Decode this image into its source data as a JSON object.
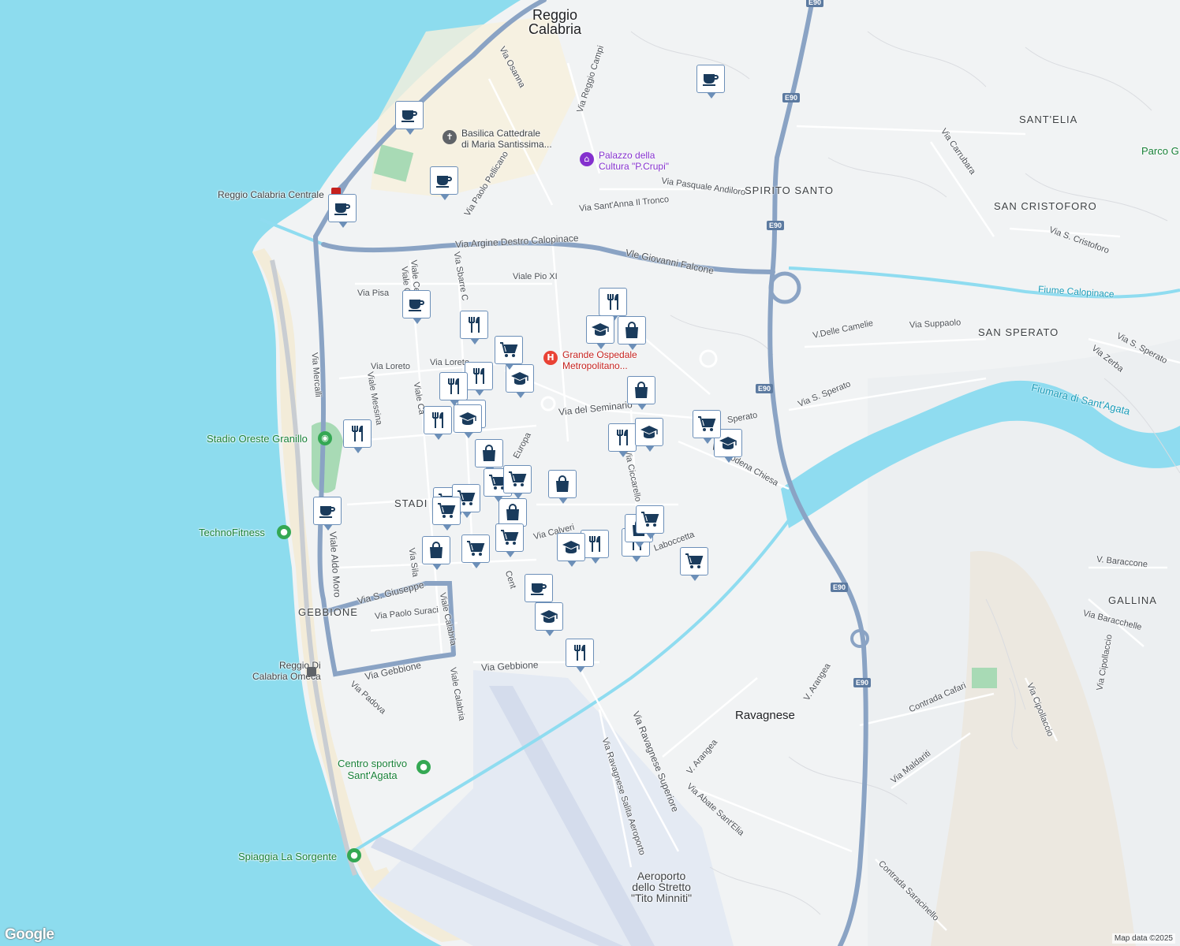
{
  "map": {
    "labels": {
      "city": "Reggio\nCalabria",
      "ravagnese": "Ravagnese",
      "aeroporto": "Aeroporto\ndello Stretto\n\"Tito Minniti\"",
      "basilica": "Basilica Cattedrale\ndi Maria Santissima...",
      "palazzo": "Palazzo della\nCultura \"P.Crupi\"",
      "ospedale": "Grande Ospedale\nMetropolitano...",
      "stazione": "Reggio Calabria Centrale",
      "omeca": "Reggio Di\nCalabria Omeca",
      "stadio": "Stadio Oreste Granillo",
      "technofitness": "TechnoFitness",
      "centro_sportivo": "Centro sportivo\nSant'Agata",
      "spiaggia": "Spiaggia La Sorgente",
      "parco": "Parco G",
      "fiume_calopinace": "Fiume Calopinace",
      "fiumara": "Fiumara di Sant'Agata"
    },
    "hoods": {
      "sant_elia": "SANT'ELIA",
      "spirito_santo": "SPIRITO SANTO",
      "san_cristoforo": "SAN CRISTOFORO",
      "san_sperato": "SAN SPERATO",
      "gallina": "GALLINA",
      "gebbione": "GEBBIONE",
      "stadio": "STADI"
    },
    "streets": {
      "osanna": "Via Osanna",
      "reggio_campi": "Via Reggio Campi",
      "paolo_pellicano": "Via Paolo Pellicano",
      "andiloro": "Via Pasquale Andiloro",
      "santanna": "Via Sant'Anna Il Tronco",
      "argine": "Via Argine Destro Calopinace",
      "falcone": "Vle Giovanni Falcone",
      "pio_xi": "Viale Pio XI",
      "pisa": "Via Pisa",
      "loreto1": "Via Loreto",
      "loreto2": "Via Loreto",
      "seminario": "Via del Seminario",
      "sperato1": "Sperato",
      "sperato2": "Via S. Sperato",
      "sperato3": "Via S. Sperato",
      "camelie": "V.Delle Camelie",
      "suppaolo": "Via Suppaolo",
      "zerba": "Via Zerba",
      "carrubara": "Via Carrubara",
      "cristoforo": "Via S. Cristoforo",
      "mercalli": "Via Mercalli",
      "messina": "Viale Messina",
      "aldo_moro": "Viale Aldo Moro",
      "sgiuseppe": "Via S. Giuseppe",
      "suraci": "Via Paolo Suraci",
      "gebbione1": "Via Gebbione",
      "gebbione2": "Via Gebbione",
      "padova": "Via Padova",
      "calabria1": "Viale Calabria",
      "calabria2": "Viale Calabria",
      "calabria3": "Viale Ca",
      "sila": "Via Sila",
      "calveri": "Via Calveri",
      "ciccarello": "Via Ciccarello",
      "modena_chiesa": "Via Modena Chiesa",
      "laboccetta": "Laboccetta",
      "europa": "Europa",
      "ravagnese_sup": "Via Ravagnese Superiore",
      "ravagnese_salita": "Via Ravagnese Salita Aeroporto",
      "arangea1": "V. Arangea",
      "arangea2": "V. Arangea",
      "abate": "Via Abate Sant'Elia",
      "saracinello": "Contrada Saracinello",
      "cafari": "Contrada Cafari",
      "maldariti": "Via Maldariti",
      "cipollaccio": "Via Cipollaccio",
      "cipollaccio2": "Via Cipollaccio",
      "baraccone": "V. Baraccone",
      "baracchelle": "Via Baracchelle",
      "sbarre": "Via Sbarre C",
      "cent": "Cent",
      "viale_ce": "Viale Ce",
      "viale_c": "Viale C"
    },
    "shields": {
      "e90": "E90"
    },
    "attribution": "Map data ©2025",
    "logo": "Google"
  },
  "markers": [
    {
      "type": "cafe",
      "icon": "cafe-icon"
    },
    {
      "type": "cafe",
      "icon": "cafe-icon"
    },
    {
      "type": "cafe",
      "icon": "cafe-icon"
    },
    {
      "type": "cafe",
      "icon": "cafe-icon"
    },
    {
      "type": "cafe",
      "icon": "cafe-icon"
    },
    {
      "type": "cafe",
      "icon": "cafe-icon"
    },
    {
      "type": "cafe",
      "icon": "cafe-icon"
    },
    {
      "type": "restaurant",
      "icon": "restaurant-icon"
    },
    {
      "type": "restaurant",
      "icon": "restaurant-icon"
    },
    {
      "type": "restaurant",
      "icon": "restaurant-icon"
    },
    {
      "type": "restaurant",
      "icon": "restaurant-icon"
    },
    {
      "type": "restaurant",
      "icon": "restaurant-icon"
    },
    {
      "type": "restaurant",
      "icon": "restaurant-icon"
    },
    {
      "type": "restaurant",
      "icon": "restaurant-icon"
    },
    {
      "type": "restaurant",
      "icon": "restaurant-icon"
    },
    {
      "type": "restaurant",
      "icon": "restaurant-icon"
    },
    {
      "type": "restaurant",
      "icon": "restaurant-icon"
    },
    {
      "type": "school",
      "icon": "school-icon"
    },
    {
      "type": "school",
      "icon": "school-icon"
    },
    {
      "type": "school",
      "icon": "school-icon"
    },
    {
      "type": "school",
      "icon": "school-icon"
    },
    {
      "type": "school",
      "icon": "school-icon"
    },
    {
      "type": "school",
      "icon": "school-icon"
    },
    {
      "type": "school",
      "icon": "school-icon"
    },
    {
      "type": "school",
      "icon": "school-icon"
    },
    {
      "type": "shopping",
      "icon": "shopping-bag-icon"
    },
    {
      "type": "shopping",
      "icon": "shopping-bag-icon"
    },
    {
      "type": "shopping",
      "icon": "shopping-bag-icon"
    },
    {
      "type": "shopping",
      "icon": "shopping-bag-icon"
    },
    {
      "type": "shopping",
      "icon": "shopping-bag-icon"
    },
    {
      "type": "shopping",
      "icon": "shopping-bag-icon"
    },
    {
      "type": "shopping",
      "icon": "shopping-bag-icon"
    },
    {
      "type": "grocery",
      "icon": "shopping-cart-icon"
    },
    {
      "type": "grocery",
      "icon": "shopping-cart-icon"
    },
    {
      "type": "grocery",
      "icon": "shopping-cart-icon"
    },
    {
      "type": "grocery",
      "icon": "shopping-cart-icon"
    },
    {
      "type": "grocery",
      "icon": "shopping-cart-icon"
    },
    {
      "type": "grocery",
      "icon": "shopping-cart-icon"
    },
    {
      "type": "grocery",
      "icon": "shopping-cart-icon"
    },
    {
      "type": "grocery",
      "icon": "shopping-cart-icon"
    },
    {
      "type": "grocery",
      "icon": "shopping-cart-icon"
    },
    {
      "type": "grocery",
      "icon": "shopping-cart-icon"
    },
    {
      "type": "grocery",
      "icon": "shopping-cart-icon"
    }
  ],
  "colors": {
    "sea": "#8ddcee",
    "land": "#f1f3f4",
    "highway": "#8aa3c4",
    "river": "#8fdcf0",
    "marker_icon": "#1a3b5c",
    "marker_border": "#6c8fb8",
    "airport": "#e4eaf3",
    "park": "#a8dab5"
  }
}
